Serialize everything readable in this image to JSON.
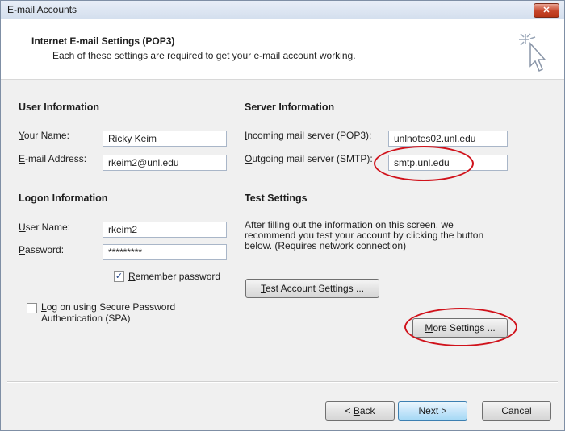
{
  "window": {
    "title": "E-mail Accounts",
    "close_label": "✕"
  },
  "header": {
    "title": "Internet E-mail Settings (POP3)",
    "subtitle": "Each of these settings are required to get your e-mail account working."
  },
  "user_info": {
    "heading": "User Information",
    "name_label_u": "Y",
    "name_label_rest": "our Name:",
    "name_value": "Ricky Keim",
    "email_label_u": "E",
    "email_label_rest": "-mail Address:",
    "email_value": "rkeim2@unl.edu"
  },
  "server_info": {
    "heading": "Server Information",
    "incoming_label_u": "I",
    "incoming_label_rest": "ncoming mail server (POP3):",
    "incoming_value": "unlnotes02.unl.edu",
    "outgoing_label_u": "O",
    "outgoing_label_rest": "utgoing mail server (SMTP):",
    "outgoing_value": "smtp.unl.edu"
  },
  "logon_info": {
    "heading": "Logon Information",
    "username_label_u": "U",
    "username_label_rest": "ser Name:",
    "username_value": "rkeim2",
    "password_label_u": "P",
    "password_label_rest": "assword:",
    "password_value": "*********",
    "remember_label_u": "R",
    "remember_label_rest": "emember password",
    "remember_checked": true,
    "spa_label_u": "L",
    "spa_label_rest": "og on using Secure Password",
    "spa_label_line2": "Authentication (SPA)",
    "spa_checked": false
  },
  "test_settings": {
    "heading": "Test Settings",
    "description": "After filling out the information on this screen, we recommend you test your account by clicking the button below. (Requires network connection)",
    "test_button_u": "T",
    "test_button_rest": "est Account Settings ...",
    "more_button_u": "M",
    "more_button_rest": "ore Settings ..."
  },
  "footer": {
    "back_prefix": "< ",
    "back_u": "B",
    "back_rest": "ack",
    "next_label": "Next >",
    "cancel_label": "Cancel"
  },
  "colors": {
    "annotation": "#d0121b",
    "dialog_bg": "#f0f0f0"
  }
}
